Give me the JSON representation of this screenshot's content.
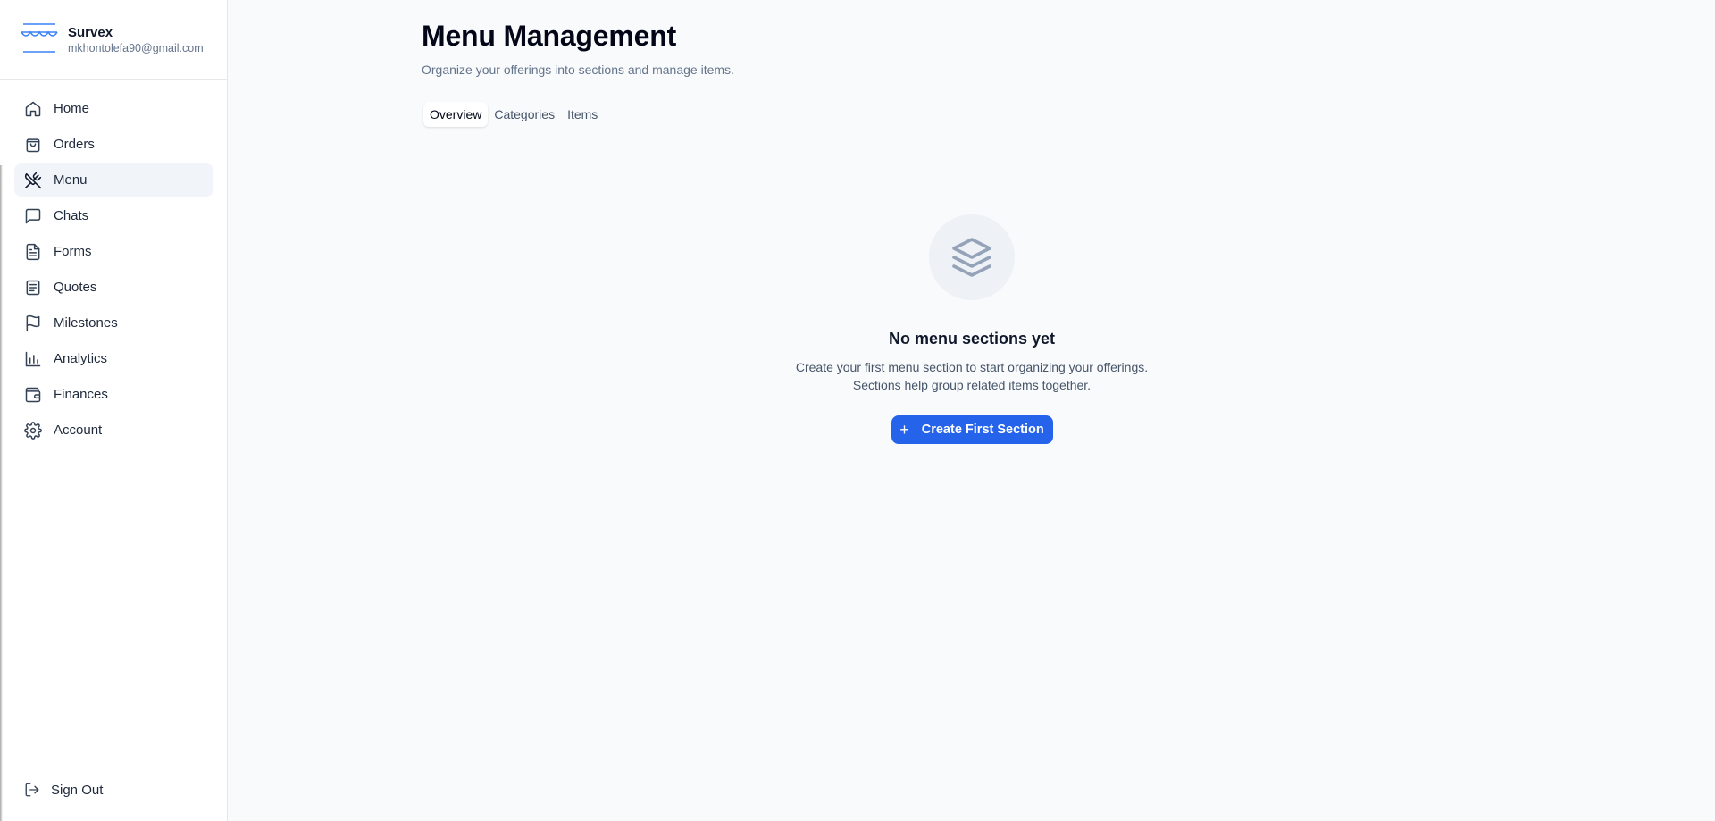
{
  "brand": {
    "name": "Survex",
    "email": "mkhontolefa90@gmail.com",
    "logo_icon": "awning-logo-icon"
  },
  "sidebar": {
    "items": [
      {
        "label": "Home",
        "icon": "home-icon",
        "active": false
      },
      {
        "label": "Orders",
        "icon": "shopping-bag-icon",
        "active": false
      },
      {
        "label": "Menu",
        "icon": "utensils-crossed-icon",
        "active": true
      },
      {
        "label": "Chats",
        "icon": "message-square-icon",
        "active": false
      },
      {
        "label": "Forms",
        "icon": "file-text-icon",
        "active": false
      },
      {
        "label": "Quotes",
        "icon": "receipt-icon",
        "active": false
      },
      {
        "label": "Milestones",
        "icon": "flag-icon",
        "active": false
      },
      {
        "label": "Analytics",
        "icon": "bar-chart-icon",
        "active": false
      },
      {
        "label": "Finances",
        "icon": "wallet-icon",
        "active": false
      },
      {
        "label": "Account",
        "icon": "settings-icon",
        "active": false
      }
    ],
    "sign_out": "Sign Out"
  },
  "main": {
    "title": "Menu Management",
    "subtitle": "Organize your offerings into sections and manage items.",
    "tabs": [
      {
        "label": "Overview",
        "active": true
      },
      {
        "label": "Categories",
        "active": false
      },
      {
        "label": "Items",
        "active": false
      }
    ],
    "empty_state": {
      "icon": "layers-icon",
      "title": "No menu sections yet",
      "description_line1": "Create your first menu section to start organizing your offerings.",
      "description_line2": "Sections help group related items together.",
      "button_label": "Create First Section"
    }
  },
  "colors": {
    "accent": "#2563eb",
    "active_nav_bg": "#f1f5f9",
    "page_bg": "#f8fafc"
  }
}
